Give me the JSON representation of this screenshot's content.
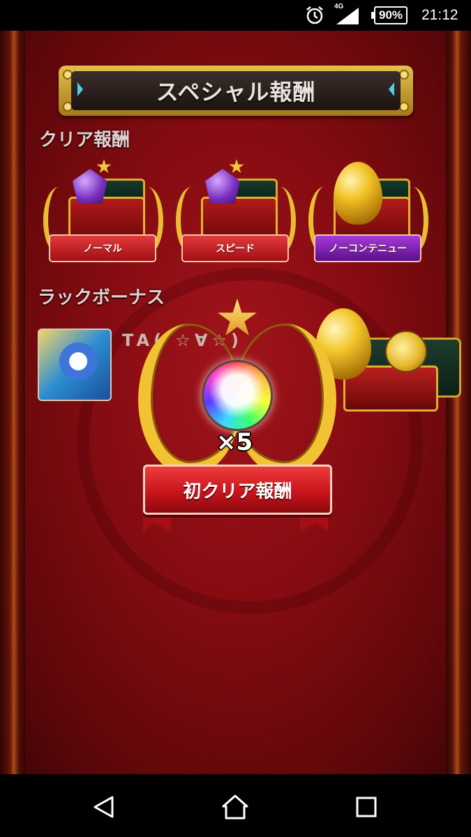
{
  "status_bar": {
    "network": "4G",
    "battery": "90%",
    "time": "21:12",
    "icons": [
      "alarm-icon",
      "signal-icon",
      "battery-icon"
    ]
  },
  "screen": {
    "title": "スペシャル報酬",
    "clear_rewards_label": "クリア報酬",
    "clear_rewards": [
      {
        "label": "ノーマル",
        "item": "gem-icon",
        "ribbon_color": "#c3121a"
      },
      {
        "label": "スピード",
        "item": "gem-icon",
        "ribbon_color": "#c3121a"
      },
      {
        "label": "ノーコンテニュー",
        "item": "egg-icon",
        "ribbon_color": "#7a1fb0"
      }
    ],
    "luck_bonus_label": "ラックボーナス",
    "luck_bonus": {
      "name": "TA( ☆∀☆)"
    }
  },
  "first_clear": {
    "count": "×5",
    "label": "初クリア報酬"
  },
  "nav": {
    "icons": [
      "back-icon",
      "home-icon",
      "recent-apps-icon"
    ]
  }
}
